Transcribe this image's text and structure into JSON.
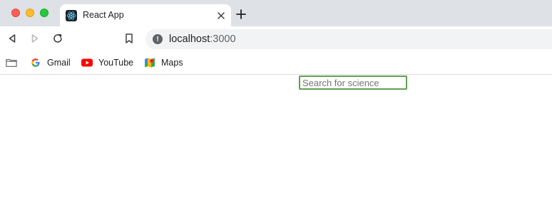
{
  "browser": {
    "tab": {
      "title": "React App",
      "favicon": "react-icon"
    },
    "address_bar": {
      "host": "localhost",
      "port": ":3000",
      "security_icon": "info-icon"
    },
    "bookmarks": [
      {
        "label": "",
        "icon": "folder-icon"
      },
      {
        "label": "Gmail",
        "icon": "google-icon"
      },
      {
        "label": "YouTube",
        "icon": "youtube-icon"
      },
      {
        "label": "Maps",
        "icon": "maps-icon"
      }
    ]
  },
  "page": {
    "search": {
      "placeholder": "Search for science",
      "value": ""
    }
  },
  "colors": {
    "tabstrip": "#dee1e6",
    "input_focus_border": "#5ea14d",
    "react_logo": "#61dafb"
  }
}
